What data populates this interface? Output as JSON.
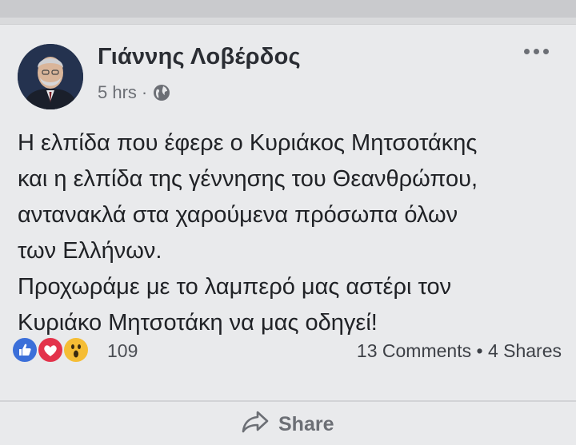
{
  "post": {
    "author": "Γιάννης Λοβέρδος",
    "timestamp": "5 hrs",
    "separator": "·",
    "privacy_icon": "globe-icon",
    "more_icon": "more-horizontal-icon",
    "text_lines": [
      "Η ελπίδα που έφερε ο Κυριάκος Μητσοτάκης",
      "και η ελπίδα της γέννησης του Θεανθρώπου,",
      "αντανακλά στα χαρούμενα πρόσωπα όλων",
      "των Ελλήνων.",
      "Προχωράμε με το λαμπερό μας αστέρι τον",
      "Κυριάκο Μητσοτάκη να μας οδηγεί!"
    ]
  },
  "reactions": {
    "icons": [
      "like-icon",
      "love-icon",
      "wow-icon"
    ],
    "count": "109",
    "colors": {
      "like": "#3b6fd9",
      "love": "#e3334b",
      "wow": "#f5bd35"
    }
  },
  "stats": {
    "comments": "13 Comments",
    "separator": "•",
    "shares": "4 Shares"
  },
  "actions": {
    "share_label": "Share",
    "share_icon": "share-arrow-icon"
  }
}
